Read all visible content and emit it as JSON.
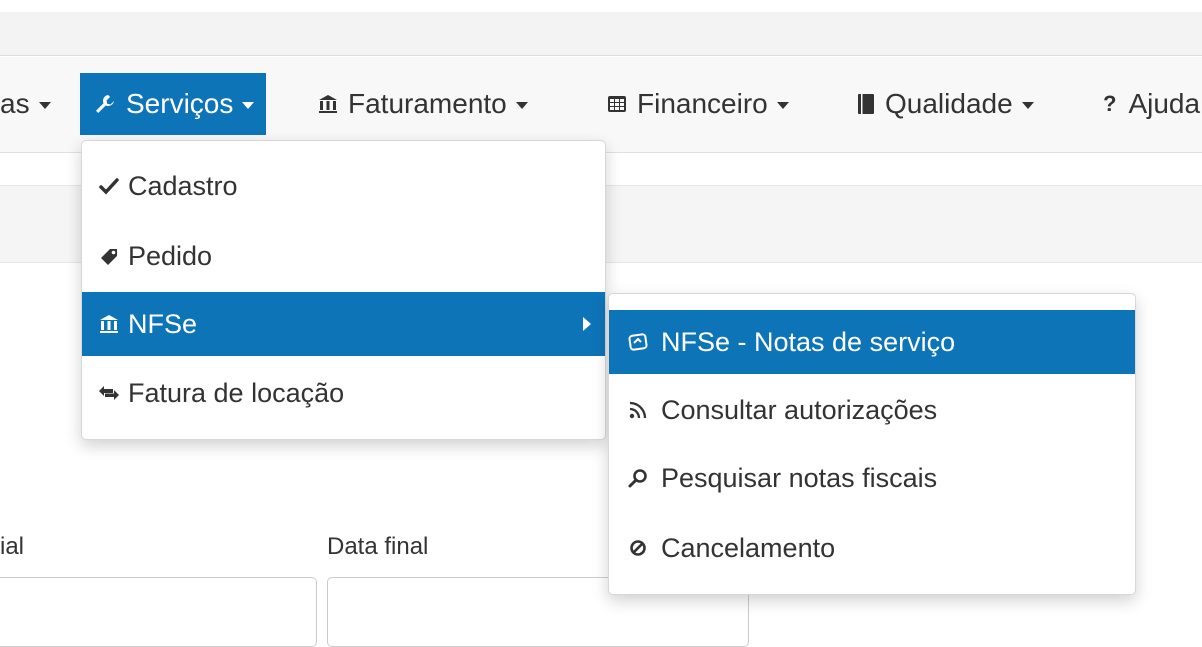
{
  "colors": {
    "accent": "#0e74b8",
    "text": "#333333"
  },
  "navbar": {
    "items": [
      {
        "label": "as",
        "icon": "none"
      },
      {
        "label": "Serviços",
        "icon": "wrench-icon"
      },
      {
        "label": "Faturamento",
        "icon": "bank-icon"
      },
      {
        "label": "Financeiro",
        "icon": "table-icon"
      },
      {
        "label": "Qualidade",
        "icon": "book-icon"
      },
      {
        "label": "Ajuda",
        "icon": "question-icon"
      }
    ]
  },
  "dropdown": {
    "items": [
      {
        "label": "Cadastro",
        "icon": "check-icon"
      },
      {
        "label": "Pedido",
        "icon": "tag-icon"
      },
      {
        "label": "NFSe",
        "icon": "bank-icon"
      },
      {
        "label": "Fatura de locação",
        "icon": "exchange-icon"
      }
    ]
  },
  "submenu": {
    "items": [
      {
        "label": "NFSe - Notas de serviço",
        "icon": "document-icon"
      },
      {
        "label": "Consultar autorizações",
        "icon": "rss-icon"
      },
      {
        "label": "Pesquisar notas fiscais",
        "icon": "search-icon"
      },
      {
        "label": "Cancelamento",
        "icon": "ban-icon"
      }
    ]
  },
  "form": {
    "start_label_partial": "ial",
    "end_label": "Data final"
  }
}
